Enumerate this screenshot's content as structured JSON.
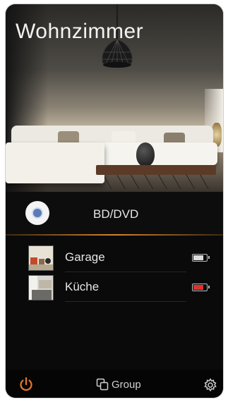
{
  "room": {
    "title": "Wohnzimmer"
  },
  "source": {
    "label": "BD/DVD",
    "icon": "disc-icon"
  },
  "zones": [
    {
      "name": "Garage",
      "battery_level": 0.8,
      "battery_color": "#dcdcdc"
    },
    {
      "name": "Küche",
      "battery_level": 0.8,
      "battery_color": "#e0332f"
    }
  ],
  "bottom_bar": {
    "power_icon": "power-icon",
    "power_color": "#e8772a",
    "group_label": "Group",
    "group_icon": "group-icon",
    "settings_icon": "gear-icon"
  }
}
